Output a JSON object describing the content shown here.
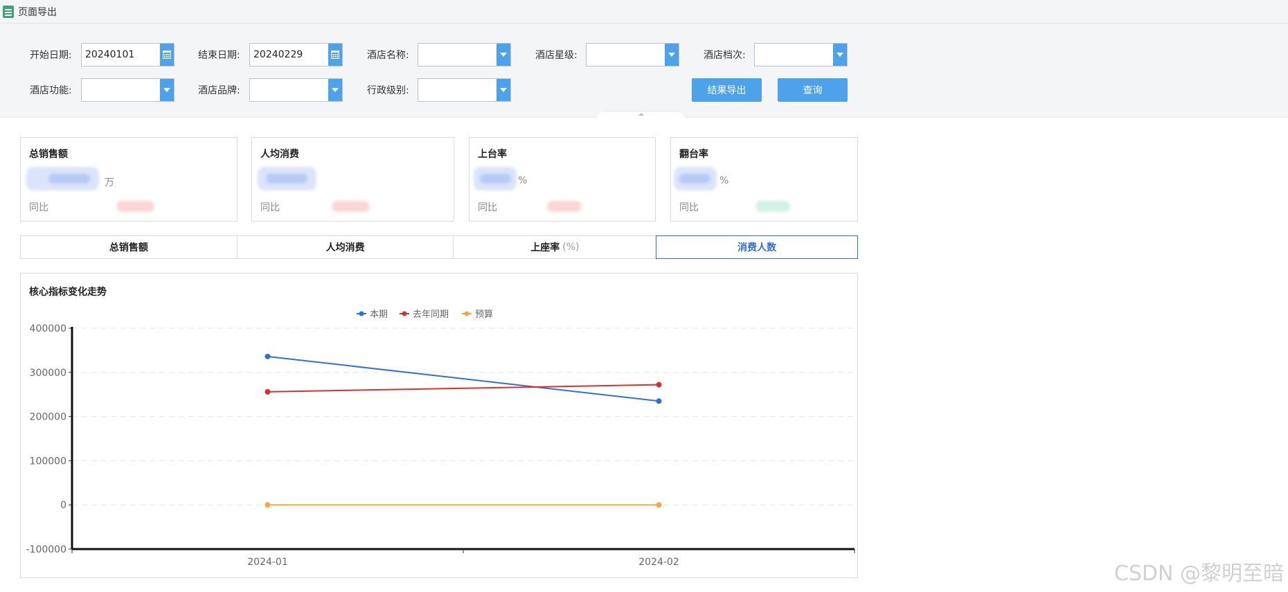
{
  "window": {
    "title": "页面导出"
  },
  "filters": {
    "start_date": {
      "label": "开始日期:",
      "value": "20240101"
    },
    "end_date": {
      "label": "结束日期:",
      "value": "20240229"
    },
    "hotel_name": {
      "label": "酒店名称:",
      "value": ""
    },
    "hotel_star": {
      "label": "酒店星级:",
      "value": ""
    },
    "hotel_grade": {
      "label": "酒店档次:",
      "value": ""
    },
    "hotel_function": {
      "label": "酒店功能:",
      "value": ""
    },
    "hotel_brand": {
      "label": "酒店品牌:",
      "value": ""
    },
    "admin_level": {
      "label": "行政级别:",
      "value": ""
    }
  },
  "actions": {
    "export_label": "结果导出",
    "query_label": "查询"
  },
  "kpis": [
    {
      "title": "总销售额",
      "unit": "万",
      "yoy_label": "同比"
    },
    {
      "title": "人均消费",
      "unit": "",
      "yoy_label": "同比"
    },
    {
      "title": "上台率",
      "unit": "%",
      "yoy_label": "同比"
    },
    {
      "title": "翻台率",
      "unit": "%",
      "yoy_label": "同比"
    }
  ],
  "tabs": [
    {
      "label": "总销售额",
      "sub": ""
    },
    {
      "label": "人均消费",
      "sub": ""
    },
    {
      "label": "上座率",
      "sub": "(%)"
    },
    {
      "label": "消费人数",
      "sub": "",
      "active": true
    }
  ],
  "chart_title": "核心指标变化走势",
  "colors": {
    "current": "#2f6fdc",
    "last_year": "#d9302e",
    "budget": "#f5a742",
    "accent": "#4da2ec"
  },
  "chart_data": {
    "type": "line",
    "title": "核心指标变化走势",
    "categories": [
      "2024-01",
      "2024-02"
    ],
    "series": [
      {
        "name": "本期",
        "values": [
          336000,
          235000
        ]
      },
      {
        "name": "去年同期",
        "values": [
          256000,
          272000
        ]
      },
      {
        "name": "预算",
        "values": [
          0,
          0
        ]
      }
    ],
    "ylim": [
      -100000,
      400000
    ],
    "yticks": [
      -100000,
      0,
      100000,
      200000,
      300000,
      400000
    ],
    "legend": "top-center",
    "grid": true
  },
  "watermark": "CSDN @黎明至暗"
}
